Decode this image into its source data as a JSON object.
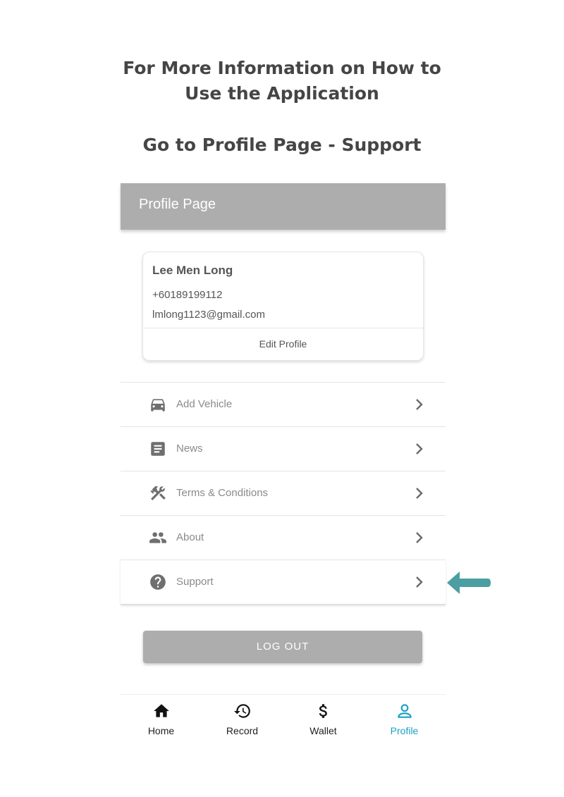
{
  "instructions": {
    "line1": "For More Information on How to",
    "line2": "Use the Application",
    "line3": "Go to Profile Page - Support"
  },
  "appbar": {
    "title": "Profile Page"
  },
  "profile": {
    "name": "Lee Men Long",
    "phone": "+60189199112",
    "email": "lmlong1123@gmail.com",
    "edit_label": "Edit Profile"
  },
  "menu": [
    {
      "label": "Add Vehicle",
      "icon": "car-icon"
    },
    {
      "label": "News",
      "icon": "article-icon"
    },
    {
      "label": "Terms & Conditions",
      "icon": "tools-icon"
    },
    {
      "label": "About",
      "icon": "people-icon"
    },
    {
      "label": "Support",
      "icon": "help-icon"
    }
  ],
  "logout_label": "LOG OUT",
  "nav": [
    {
      "label": "Home",
      "icon": "home-icon"
    },
    {
      "label": "Record",
      "icon": "history-icon"
    },
    {
      "label": "Wallet",
      "icon": "dollar-icon"
    },
    {
      "label": "Profile",
      "icon": "person-icon",
      "active": true
    }
  ],
  "colors": {
    "appbar": "#adadad",
    "accent": "#1aa1c2",
    "arrow": "#4b9ea1"
  }
}
